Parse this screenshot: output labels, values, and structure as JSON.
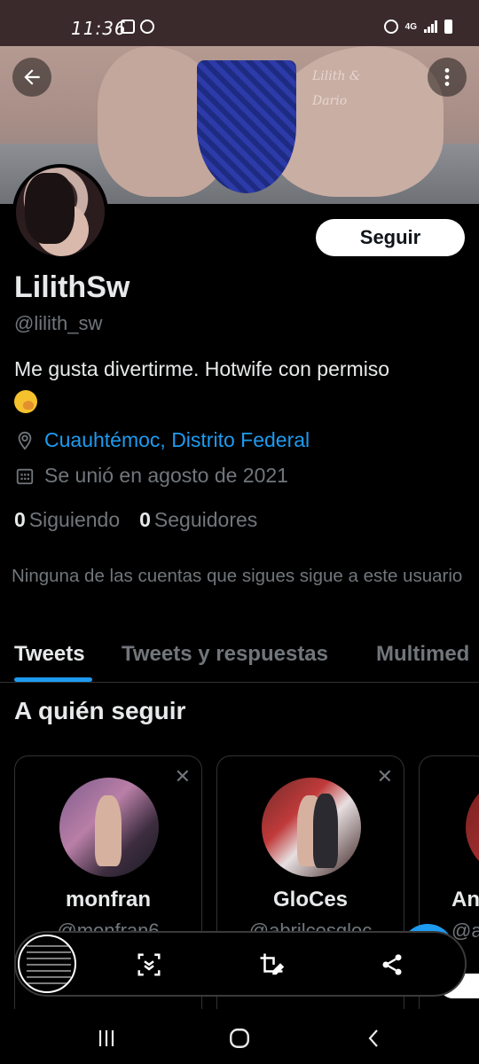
{
  "status_bar": {
    "time": "11:36",
    "network": "4G"
  },
  "banner": {
    "watermark_line1": "Lilith &",
    "watermark_line2": "Dario"
  },
  "profile": {
    "follow_label": "Seguir",
    "display_name": "LilithSw",
    "handle": "@lilith_sw",
    "bio": "Me gusta divertirme. Hotwife con permiso",
    "bio_emoji": "face-with-hand-over-mouth",
    "location": "Cuauhtémoc, Distrito Federal",
    "joined": "Se unió en agosto de 2021",
    "following_count": "0",
    "following_label": "Siguiendo",
    "followers_count": "0",
    "followers_label": "Seguidores",
    "not_followed_note": "Ninguna de las cuentas que sigues sigue a este usuario"
  },
  "tabs": [
    {
      "label": "Tweets",
      "active": true
    },
    {
      "label": "Tweets y respuestas",
      "active": false
    },
    {
      "label": "Multimed",
      "active": false
    }
  ],
  "who_to_follow": {
    "title": "A quién seguir",
    "cards": [
      {
        "name": "monfran",
        "handle": "@monfran6"
      },
      {
        "name": "GloCes",
        "handle": "@abrilcesgloc"
      },
      {
        "name": "An",
        "handle": "@a"
      }
    ]
  },
  "colors": {
    "accent": "#1d9bf0",
    "background": "#000000",
    "muted": "#71767b",
    "text": "#e7e9ea"
  }
}
